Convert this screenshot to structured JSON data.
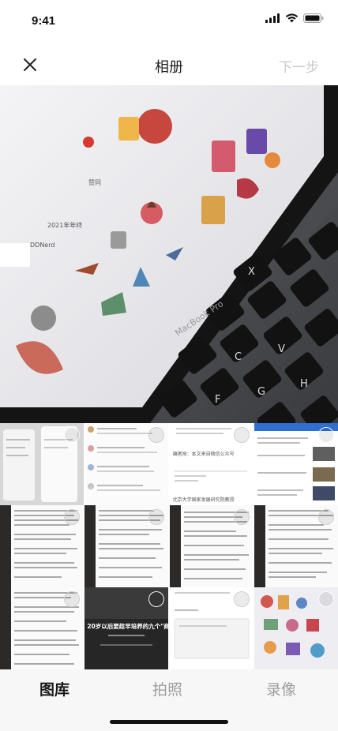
{
  "status": {
    "time": "9:41"
  },
  "nav": {
    "title": "相册",
    "next_label": "下一步"
  },
  "preview": {
    "screen_texts": [
      "2021年年终",
      "DDNerd",
      "赞同",
      "MacBook Pro"
    ]
  },
  "grid": {
    "cells": [
      {
        "kind": "phone-screens"
      },
      {
        "kind": "chat-doc"
      },
      {
        "kind": "article",
        "text_a": "编者按：本文来自微信公众号",
        "text_b": "北京大学国家发展研究院教授"
      },
      {
        "kind": "news-list"
      },
      {
        "kind": "dark-notes"
      },
      {
        "kind": "dark-notes"
      },
      {
        "kind": "dark-notes"
      },
      {
        "kind": "dark-notes"
      },
      {
        "kind": "dark-notes"
      },
      {
        "kind": "video-cover",
        "caption": "20岁以后要趁早培养的九个\"商\""
      },
      {
        "kind": "comment-form"
      },
      {
        "kind": "stickers"
      }
    ]
  },
  "tabs": [
    {
      "label": "图库",
      "active": true
    },
    {
      "label": "拍照",
      "active": false
    },
    {
      "label": "录像",
      "active": false
    }
  ],
  "colors": {
    "accent": "#1a1a1a",
    "inactive": "#9e9e9e",
    "disabled": "#c9c9c9"
  }
}
